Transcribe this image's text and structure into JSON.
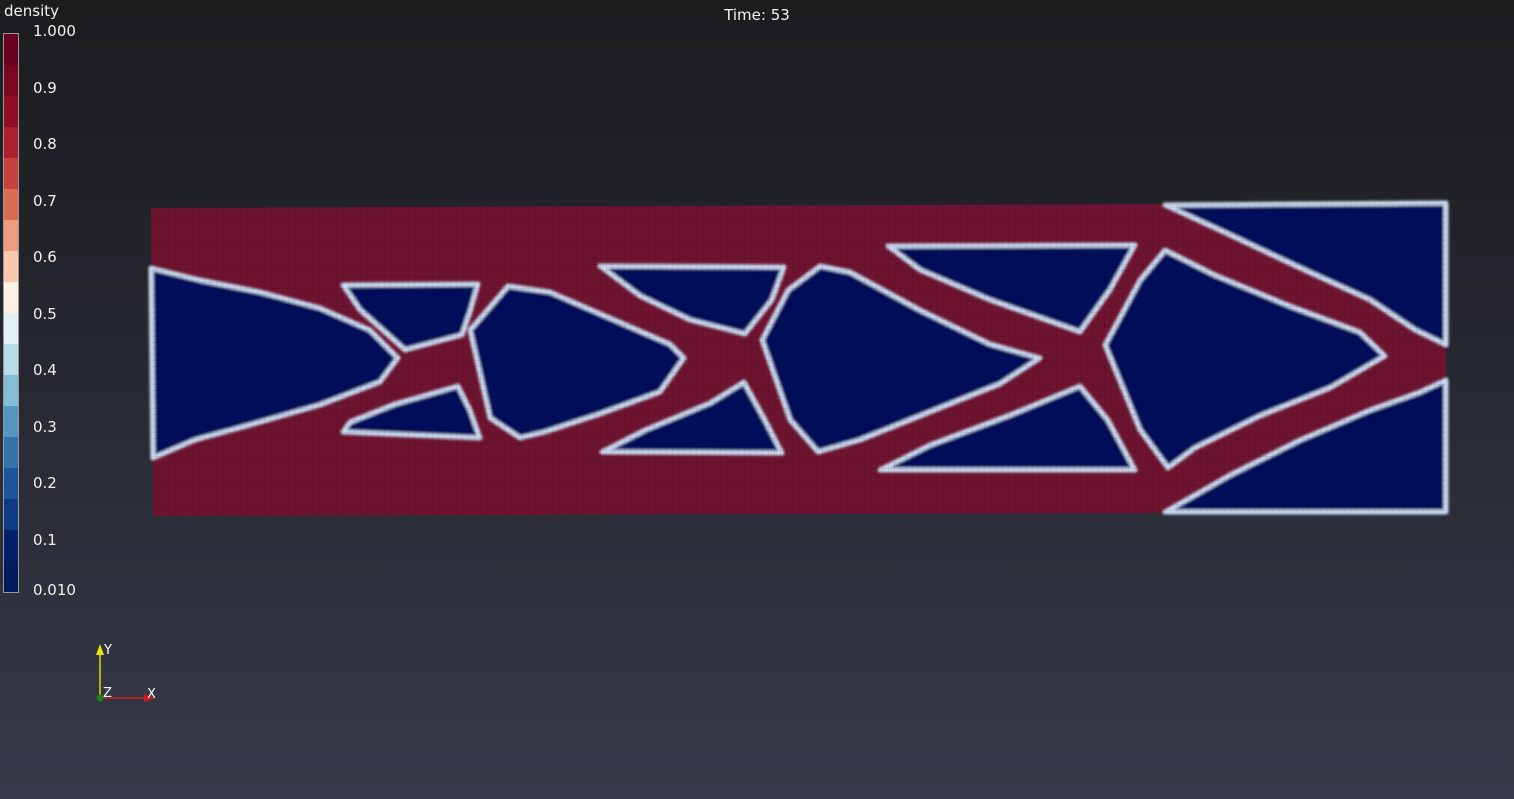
{
  "header": {
    "time_label": "Time: 53"
  },
  "legend": {
    "title": "density",
    "ticks": [
      "1.000",
      "0.9",
      "0.8",
      "0.7",
      "0.6",
      "0.5",
      "0.4",
      "0.3",
      "0.2",
      "0.1",
      "0.010"
    ],
    "bands": [
      "#67001f",
      "#7a0622",
      "#8f0e25",
      "#ac1f2c",
      "#c6423b",
      "#dc6b56",
      "#ee9b7e",
      "#f9c9ae",
      "#fdf1e6",
      "#e3f1f5",
      "#b8dde8",
      "#85bdd6",
      "#5596c0",
      "#3472ab",
      "#1e5499",
      "#0f3a86",
      "#061f69",
      "#031a5c"
    ]
  },
  "scene": {
    "solid_color": "#6e1430",
    "void_color": "#04115a",
    "edge_color": "#c8d8ef"
  },
  "axes": {
    "y": "Y",
    "z": "Z",
    "x": "X"
  }
}
